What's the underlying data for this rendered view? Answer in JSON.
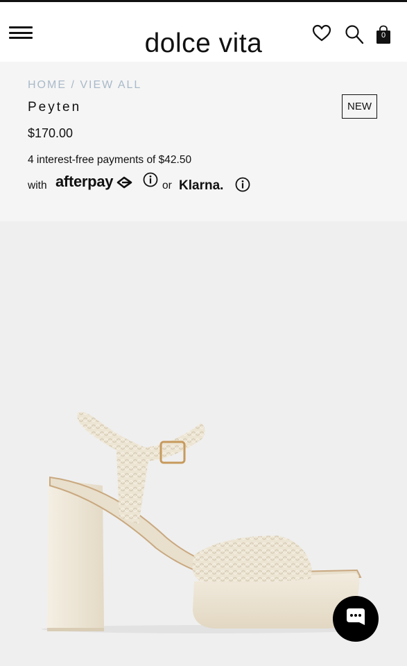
{
  "header": {
    "menu_icon": "hamburger-menu-icon",
    "brand": "dolce vita",
    "wishlist_icon": "heart-icon",
    "search_icon": "search-icon",
    "bag_icon": "shopping-bag-icon",
    "bag_count": "0"
  },
  "breadcrumb": {
    "home": "HOME",
    "separator": "/",
    "current": "VIEW ALL"
  },
  "product": {
    "name": "Peyten",
    "badge": "NEW",
    "price": "$170.00",
    "image_icon": "platform-sandal-image",
    "installments_text": "4 interest-free payments of $42.50",
    "with_text": "with",
    "afterpay_label": "afterpay",
    "or_text": "or",
    "klarna_label": "Klarna."
  },
  "chat": {
    "icon": "chat-bubble-icon"
  },
  "colors": {
    "text": "#111111",
    "breadcrumb": "#a9b9c9",
    "background": "#efefef",
    "sandal": "#eee7d8"
  }
}
